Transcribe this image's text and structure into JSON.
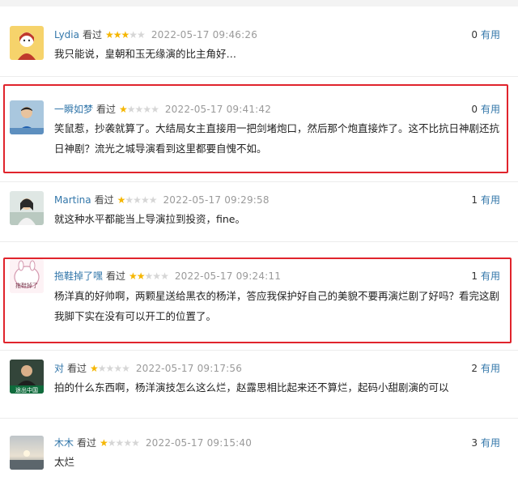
{
  "reviews": [
    {
      "user": "Lydia",
      "watched": "看过",
      "stars_on": "★★★",
      "stars_off": "★★",
      "time": "2022-05-17 09:46:26",
      "useful_count": "0",
      "useful_label": "有用",
      "text": "我只能说，皇朝和玉无缘演的比主角好…"
    },
    {
      "user": "一瞬如梦",
      "watched": "看过",
      "stars_on": "★",
      "stars_off": "★★★★",
      "time": "2022-05-17 09:41:42",
      "useful_count": "0",
      "useful_label": "有用",
      "text": "笑鼠惹，抄袭就算了。大结局女主直接用一把剑堵炮口，然后那个炮直接炸了。这不比抗日神剧还抗日神剧？流光之城导演看到这里都要自愧不如。"
    },
    {
      "user": "Martina",
      "watched": "看过",
      "stars_on": "★",
      "stars_off": "★★★★",
      "time": "2022-05-17 09:29:58",
      "useful_count": "1",
      "useful_label": "有用",
      "text": "就这种水平都能当上导演拉到投资，fine。"
    },
    {
      "user": "拖鞋掉了嘿",
      "watched": "看过",
      "stars_on": "★★",
      "stars_off": "★★★",
      "time": "2022-05-17 09:24:11",
      "useful_count": "1",
      "useful_label": "有用",
      "text": "杨洋真的好帅啊，两颗星送给黑衣的杨洋，答应我保护好自己的美貌不要再演烂剧了好吗？看完这剧我脚下实在没有可以开工的位置了。"
    },
    {
      "user": "对",
      "watched": "看过",
      "stars_on": "★",
      "stars_off": "★★★★",
      "time": "2022-05-17 09:17:56",
      "useful_count": "2",
      "useful_label": "有用",
      "text": "拍的什么东西啊，杨洋演技怎么这么烂，赵露思相比起来还不算烂，起码小甜剧演的可以"
    },
    {
      "user": "木木",
      "watched": "看过",
      "stars_on": "★",
      "stars_off": "★★★★",
      "time": "2022-05-17 09:15:40",
      "useful_count": "3",
      "useful_label": "有用",
      "text": "太烂"
    }
  ],
  "avatar_texts": {
    "r4": "拖鞋掉了",
    "r5": "途出中国"
  },
  "colors": {
    "highlight": "#e0242c",
    "username": "#3377aa",
    "star": "#f5b600"
  }
}
